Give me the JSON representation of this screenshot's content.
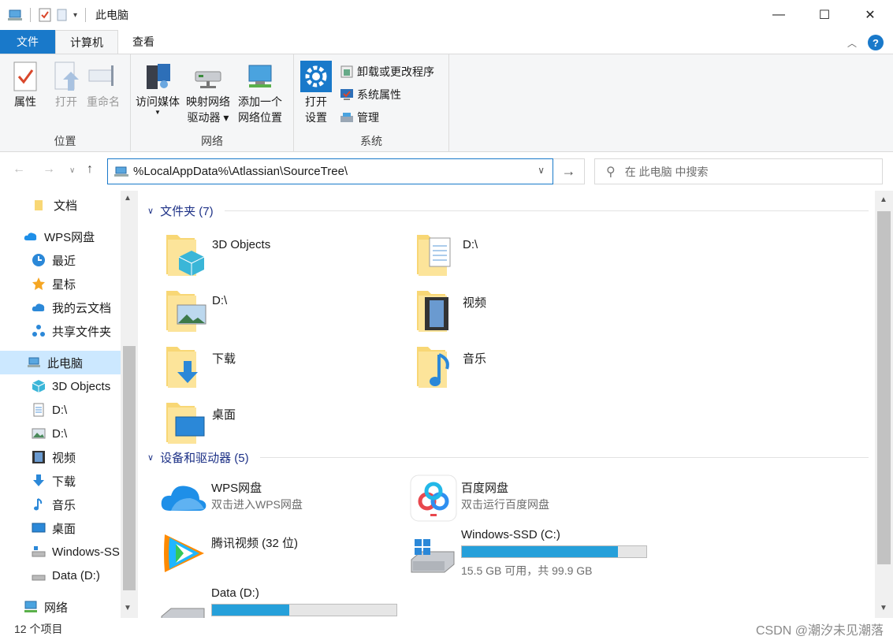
{
  "window": {
    "title": "此电脑",
    "minimize": "—",
    "maximize": "☐",
    "close": "✕"
  },
  "ribbon_tabs": [
    "文件",
    "计算机",
    "查看"
  ],
  "ribbon": {
    "groups": [
      {
        "label": "位置",
        "buttons": [
          "属性",
          "打开",
          "重命名"
        ]
      },
      {
        "label": "网络",
        "buttons": [
          "访问媒体",
          "映射网络",
          "驱动器",
          "添加一个",
          "网络位置"
        ]
      },
      {
        "label": "系统",
        "buttons": [
          "打开",
          "设置"
        ],
        "small_buttons": [
          "卸载或更改程序",
          "系统属性",
          "管理"
        ]
      }
    ]
  },
  "address": {
    "path": "%LocalAppData%\\Atlassian\\SourceTree\\",
    "search_placeholder": "在 此电脑 中搜索"
  },
  "sidebar": {
    "items": [
      {
        "label": "文档",
        "icon": "document-folder-icon"
      },
      {
        "label": "WPS网盘",
        "icon": "cloud-icon"
      },
      {
        "label": "最近",
        "icon": "clock-icon"
      },
      {
        "label": "星标",
        "icon": "star-icon"
      },
      {
        "label": "我的云文档",
        "icon": "cloud-icon"
      },
      {
        "label": "共享文件夹",
        "icon": "share-icon"
      },
      {
        "label": "此电脑",
        "icon": "computer-icon",
        "selected": true
      },
      {
        "label": "3D Objects",
        "icon": "cube-icon"
      },
      {
        "label": "D:\\",
        "icon": "document-icon"
      },
      {
        "label": "D:\\",
        "icon": "picture-icon"
      },
      {
        "label": "视频",
        "icon": "film-icon"
      },
      {
        "label": "下载",
        "icon": "download-icon"
      },
      {
        "label": "音乐",
        "icon": "music-icon"
      },
      {
        "label": "桌面",
        "icon": "desktop-icon"
      },
      {
        "label": "Windows-SSD (C:)",
        "icon": "drive-icon"
      },
      {
        "label": "Data (D:)",
        "icon": "drive-icon"
      },
      {
        "label": "网络",
        "icon": "network-icon"
      }
    ]
  },
  "folders_section": {
    "title": "文件夹 (7)",
    "items": [
      {
        "name": "3D Objects",
        "icon": "cube-icon"
      },
      {
        "name": "D:\\",
        "icon": "document-icon"
      },
      {
        "name": "D:\\",
        "icon": "picture-icon"
      },
      {
        "name": "视频",
        "icon": "film-icon"
      },
      {
        "name": "下载",
        "icon": "download-icon"
      },
      {
        "name": "音乐",
        "icon": "music-icon"
      },
      {
        "name": "桌面",
        "icon": "desktop-icon"
      }
    ]
  },
  "devices_section": {
    "title": "设备和驱动器 (5)",
    "items": [
      {
        "name": "WPS网盘",
        "sub": "双击进入WPS网盘"
      },
      {
        "name": "百度网盘",
        "sub": "双击运行百度网盘"
      },
      {
        "name": "腾讯视频 (32 位)",
        "sub": ""
      },
      {
        "name": "Windows-SSD (C:)",
        "sub": "15.5 GB 可用，共 99.9 GB",
        "used_fraction": 0.845
      },
      {
        "name": "Data (D:)",
        "sub": "",
        "used_fraction": 0.42
      }
    ]
  },
  "status": {
    "item_count": "12 个项目"
  },
  "watermark": "CSDN @潮汐未见潮落",
  "colors": {
    "accent": "#1979ca",
    "drive_bar": "#26a0da",
    "folder": "#f8d775",
    "selected_bg": "#cce8ff"
  }
}
